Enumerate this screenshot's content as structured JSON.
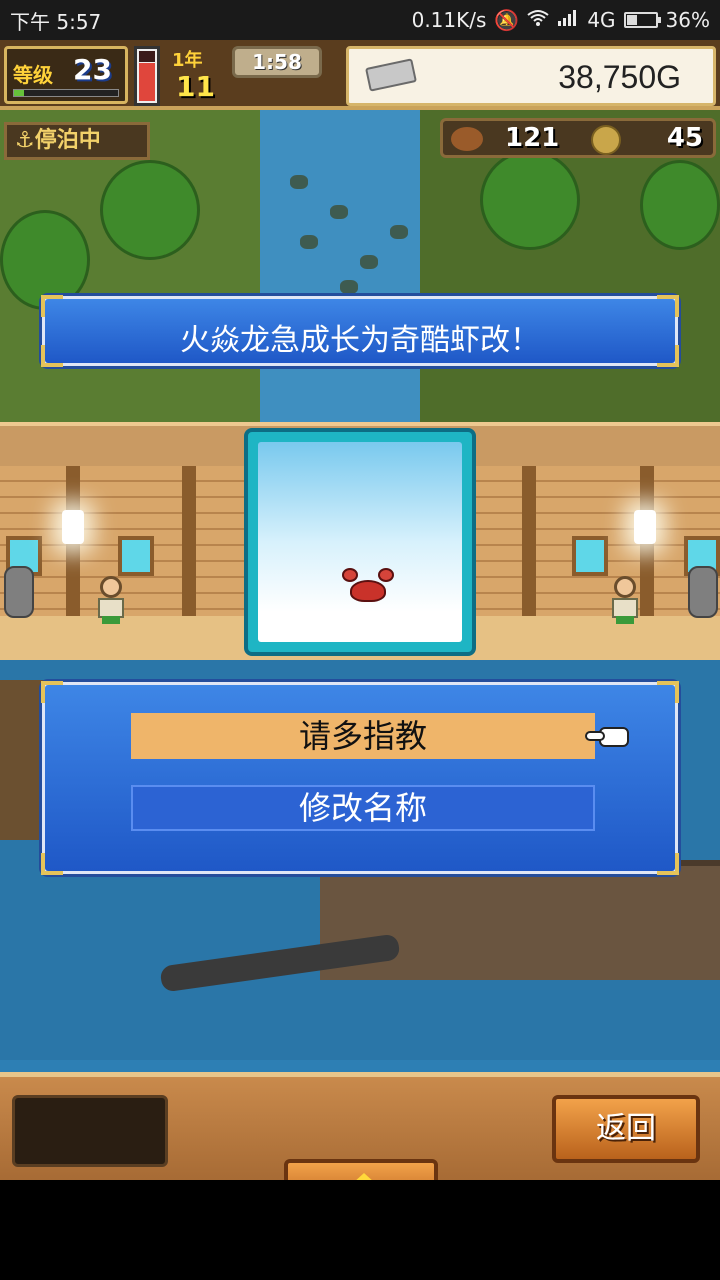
{
  "status_bar": {
    "time": "下午 5:57",
    "network_speed": "0.11K/s",
    "network_type": "4G",
    "battery": "36%"
  },
  "hud": {
    "level_label": "等级",
    "level_value": "23",
    "year_label": "1年",
    "year_value": "11",
    "clock": "1:58",
    "gold": "38,750G",
    "moored_label": "停泊中",
    "food_count": "121",
    "coin_count": "45"
  },
  "banner": {
    "message": "火焱龙急成长为奇酷虾改！"
  },
  "menu": {
    "options": [
      "请多指教",
      "修改名称"
    ]
  },
  "bottom_bar": {
    "back_label": "返回"
  }
}
